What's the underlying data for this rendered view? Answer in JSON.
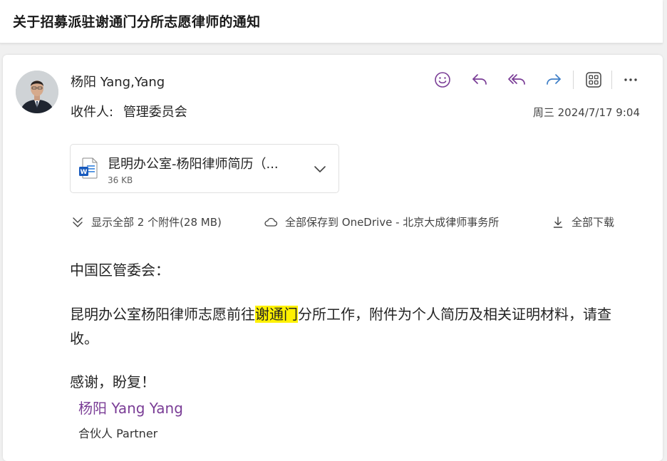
{
  "subject": "关于招募派驻谢通门分所志愿律师的通知",
  "sender": {
    "name": "杨阳 Yang,Yang"
  },
  "recipients": {
    "label": "收件人:",
    "value": "管理委员会"
  },
  "date": "周三 2024/7/17 9:04",
  "toolbar": {
    "buttons": [
      {
        "icon": "emoji-icon"
      },
      {
        "icon": "reply-icon"
      },
      {
        "icon": "reply-all-icon"
      },
      {
        "icon": "forward-icon"
      },
      {
        "icon": "apps-icon"
      },
      {
        "icon": "more-icon"
      }
    ]
  },
  "attachment": {
    "name": "昆明办公室-杨阳律师简历（...",
    "size": "36 KB",
    "icon": "word-file-icon"
  },
  "attachment_actions": {
    "show_all": "显示全部 2 个附件(28 MB)",
    "save_all": "全部保存到 OneDrive - 北京大成律师事务所",
    "download_all": "全部下载"
  },
  "body": {
    "greeting": "中国区管委会：",
    "main_before": "昆明办公室杨阳律师志愿前往",
    "main_highlight": "谢通门",
    "main_after": "分所工作，附件为个人简历及相关证明材料，请查收。",
    "thanks": "感谢，盼复！"
  },
  "signature": {
    "name": "杨阳 Yang Yang",
    "title": "合伙人 Partner"
  },
  "colors": {
    "accent_purple": "#7a3d96",
    "highlight": "#fff100",
    "word_blue": "#185abd"
  }
}
